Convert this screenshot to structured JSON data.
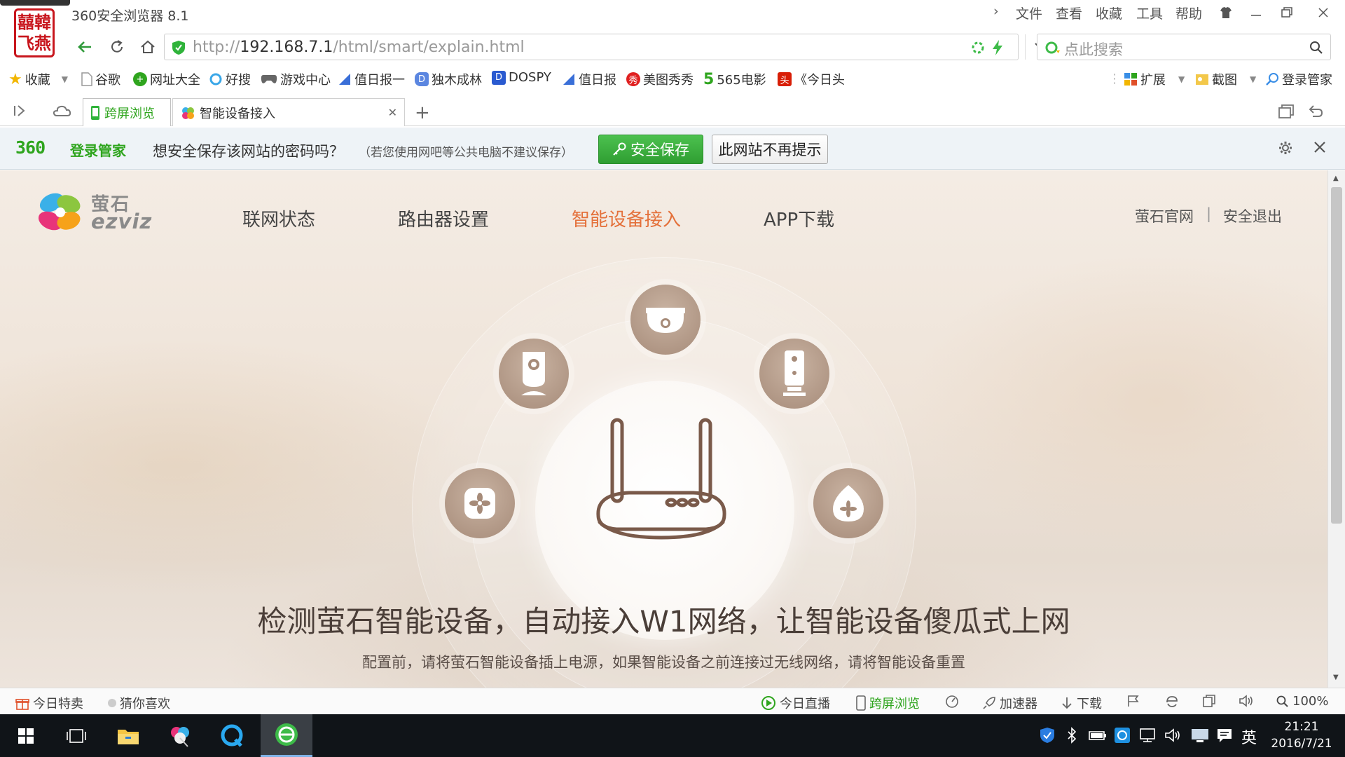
{
  "window": {
    "title": "360安全浏览器 8.1",
    "logo_text": "囍韓\n飞燕",
    "menu": [
      "文件",
      "查看",
      "收藏",
      "工具",
      "帮助"
    ]
  },
  "address": {
    "url_prefix": "http://",
    "url_host": "192.168.7.1",
    "url_path": "/html/smart/explain.html",
    "search_placeholder": "点此搜索"
  },
  "bookmarks": [
    {
      "label": "收藏",
      "icon": "star-icon",
      "color": "#f2b600"
    },
    {
      "label": "谷歌",
      "icon": "page-icon",
      "color": "#999999"
    },
    {
      "label": "网址大全",
      "icon": "plus-circle-icon",
      "color": "#2fa51e"
    },
    {
      "label": "好搜",
      "icon": "search-ring-icon",
      "color": "#3aa7e8"
    },
    {
      "label": "游戏中心",
      "icon": "gamepad-icon",
      "color": "#666666"
    },
    {
      "label": "值日报一",
      "icon": "arrow-doc-icon",
      "color": "#3a6fd8"
    },
    {
      "label": "独木成林",
      "icon": "d-icon",
      "color": "#3a6fd8"
    },
    {
      "label": "DOSPY",
      "icon": "d-square-icon",
      "color": "#2a5ad0"
    },
    {
      "label": "值日报",
      "icon": "arrow-doc-icon",
      "color": "#3a6fd8"
    },
    {
      "label": "美图秀秀",
      "icon": "meitu-icon",
      "color": "#e02020"
    },
    {
      "label": "565电影",
      "icon": "five-icon",
      "color": "#2fa51e"
    },
    {
      "label": "《今日头",
      "icon": "toutiao-icon",
      "color": "#d81e06"
    }
  ],
  "bookmarks_right": [
    "扩展",
    "截图",
    "登录管家"
  ],
  "tabs": [
    {
      "label": "跨屏浏览",
      "icon": "phone-icon"
    },
    {
      "label": "智能设备接入",
      "icon": "ezviz-tab-icon"
    }
  ],
  "pwbar": {
    "brand_num": "360",
    "brand_text": "登录管家",
    "question": "想安全保存该网站的密码吗？",
    "note": "（若您使用网吧等公共电脑不建议保存）",
    "save_button": "安全保存",
    "never_button": "此网站不再提示"
  },
  "page": {
    "brand_cn": "萤石",
    "brand_en": "ezviz",
    "nav": [
      "联网状态",
      "路由器设置",
      "智能设备接入",
      "APP下载"
    ],
    "active_nav": "智能设备接入",
    "active_color": "#e4703a",
    "top_links": [
      "萤石官网",
      "安全退出"
    ],
    "separator": "|",
    "headline": "检测萤石智能设备，自动接入W1网络，让智能设备傻瓜式上网",
    "subline": "配置前，请将萤石智能设备插上电源，如果智能设备之前连接过无线网络，请将智能设备重置"
  },
  "statusbar": {
    "left": [
      "今日特卖",
      "猜你喜欢"
    ],
    "right": [
      "今日直播",
      "跨屏浏览",
      "加速器",
      "下载"
    ],
    "zoom": "100%"
  },
  "taskbar": {
    "time": "21:21",
    "date": "2016/7/21",
    "ime": "英"
  }
}
